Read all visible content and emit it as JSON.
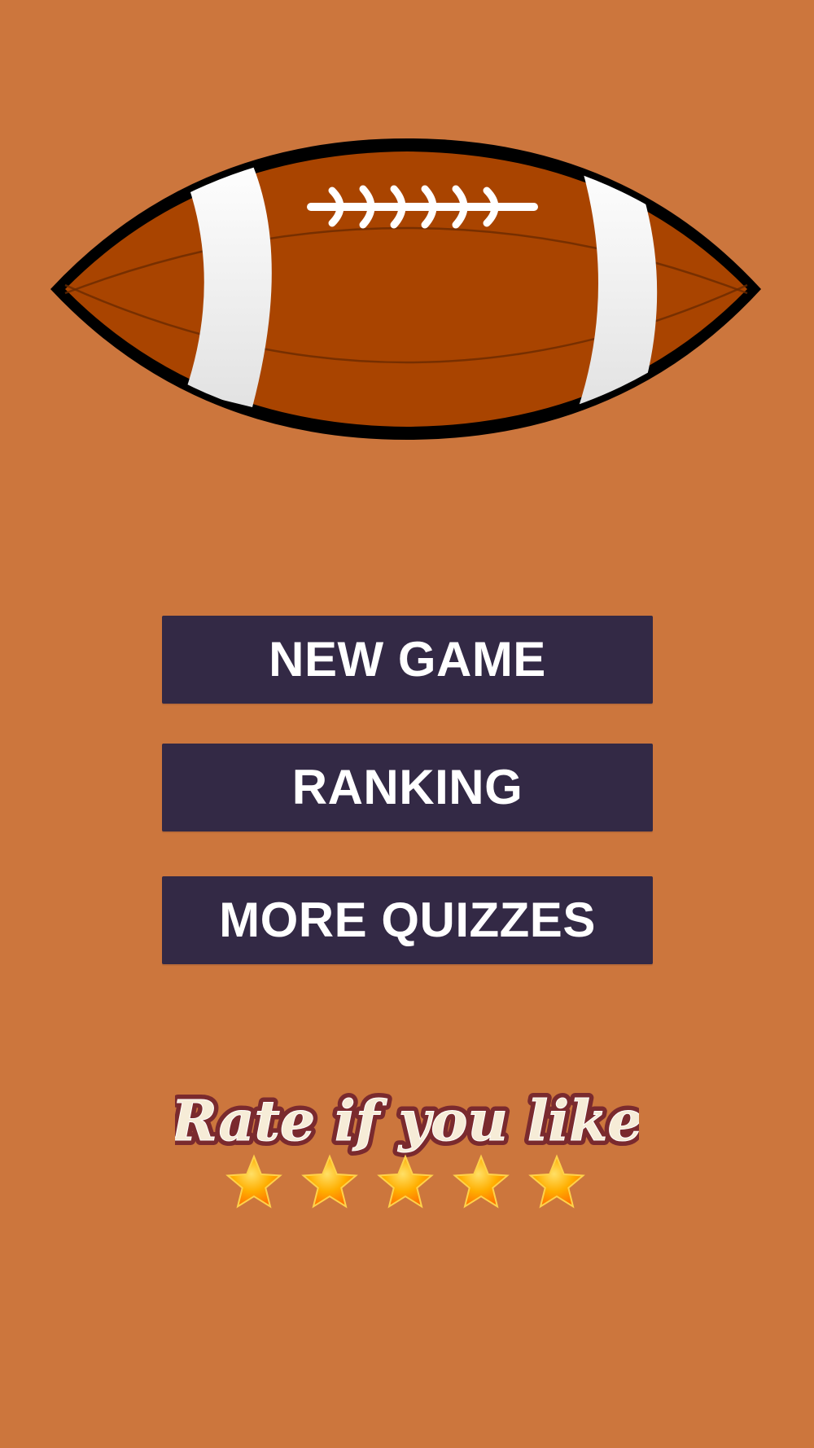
{
  "app": {
    "background_color": "#cc763d"
  },
  "logo": {
    "icon": "american-football-icon",
    "ball_color": "#a94400",
    "stripe_color": "#ffffff",
    "outline_color": "#000000"
  },
  "menu": {
    "button_color": "#332945",
    "text_color": "#ffffff",
    "items": [
      {
        "label": "NEW GAME"
      },
      {
        "label": "RANKING"
      },
      {
        "label": "MORE QUIZZES"
      }
    ]
  },
  "rating": {
    "text": "Rate if you like",
    "text_fill": "#f6ecd7",
    "text_outline": "#7a2a2e",
    "star_count": 5,
    "star_color": "#ff9a00"
  }
}
